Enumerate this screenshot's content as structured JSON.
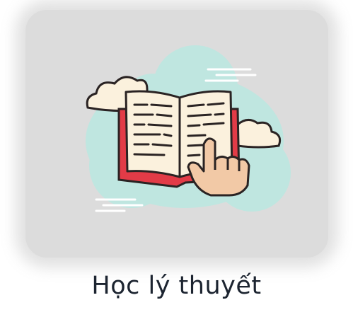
{
  "card": {
    "label": "Học lý thuyết",
    "icon": "open-book-pointing-hand-icon"
  },
  "colors": {
    "tile_background": "#dcdcdc",
    "cloud_blob": "#bfe6e0",
    "book_cover": "#e23b47",
    "book_pages": "#fbf1dd",
    "hand": "#f2c9a6",
    "outline": "#2a2323",
    "label_text": "#1c2430"
  }
}
